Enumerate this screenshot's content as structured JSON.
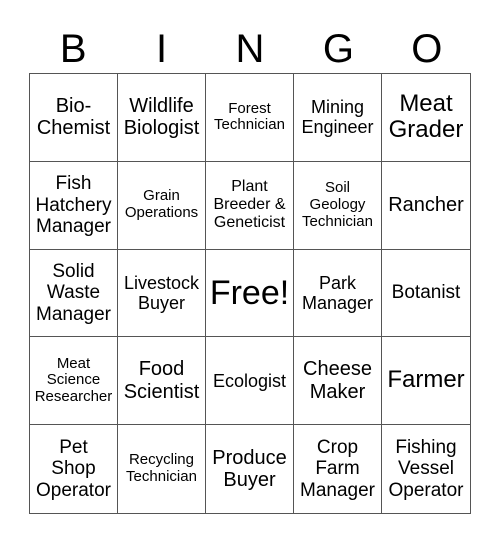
{
  "header": [
    "B",
    "I",
    "N",
    "G",
    "O"
  ],
  "cells": [
    "Bio-\nChemist",
    "Wildlife\nBiologist",
    "Forest\nTechnician",
    "Mining\nEngineer",
    "Meat\nGrader",
    "Fish\nHatchery\nManager",
    "Grain\nOperations",
    "Plant\nBreeder &\nGeneticist",
    "Soil\nGeology\nTechnician",
    "Rancher",
    "Solid\nWaste\nManager",
    "Livestock\nBuyer",
    "Free!",
    "Park\nManager",
    "Botanist",
    "Meat\nScience\nResearcher",
    "Food\nScientist",
    "Ecologist",
    "Cheese\nMaker",
    "Farmer",
    "Pet\nShop\nOperator",
    "Recycling\nTechnician",
    "Produce\nBuyer",
    "Crop\nFarm\nManager",
    "Fishing\nVessel\nOperator"
  ]
}
